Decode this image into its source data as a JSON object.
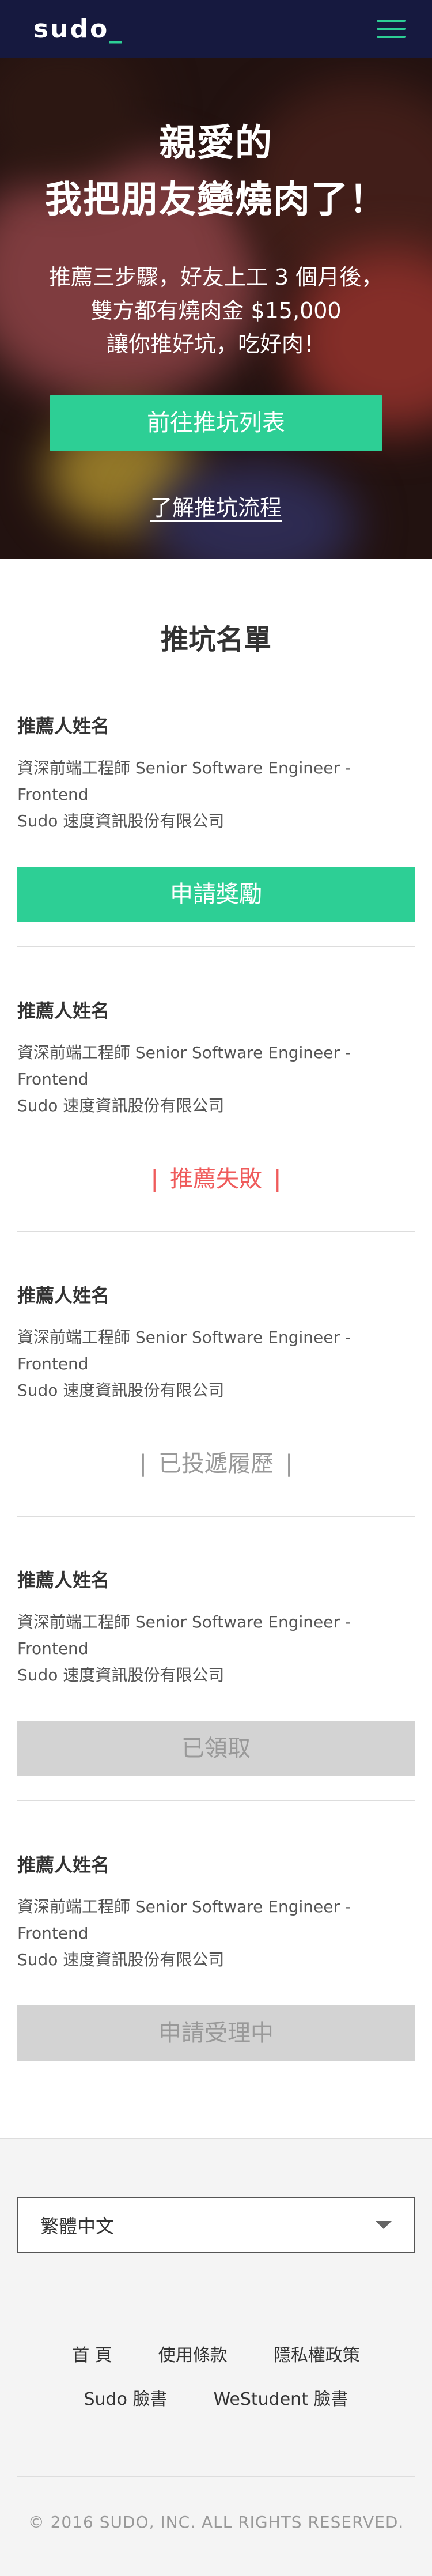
{
  "header": {
    "logo_text": "sudo",
    "logo_cursor": "_",
    "menu_icon": "hamburger-icon",
    "accent_color": "#2dcf95",
    "bg_color": "#16193f"
  },
  "hero": {
    "title_line1": "親愛的",
    "title_line2": "我把朋友變燒肉了！",
    "sub_line1": "推薦三步驟，好友上工 3 個月後，",
    "sub_line2": "雙方都有燒肉金 $15,000",
    "sub_line3": "讓你推好坑，吃好肉！",
    "button_label": "前往推坑列表",
    "link_label": "了解推坑流程"
  },
  "list": {
    "title": "推坑名單",
    "entries": [
      {
        "name": "推薦人姓名",
        "job": "資深前端工程師 Senior Software Engineer - Frontend",
        "company": "Sudo 速度資訊股份有限公司",
        "action_type": "button-primary",
        "action_label": "申請獎勵"
      },
      {
        "name": "推薦人姓名",
        "job": "資深前端工程師 Senior Software Engineer - Frontend",
        "company": "Sudo 速度資訊股份有限公司",
        "action_type": "status-fail",
        "action_label": "推薦失敗",
        "status_color": "#ef5b5b"
      },
      {
        "name": "推薦人姓名",
        "job": "資深前端工程師 Senior Software Engineer - Frontend",
        "company": "Sudo 速度資訊股份有限公司",
        "action_type": "status-sent",
        "action_label": "已投遞履歷",
        "status_color": "#999999"
      },
      {
        "name": "推薦人姓名",
        "job": "資深前端工程師 Senior Software Engineer - Frontend",
        "company": "Sudo 速度資訊股份有限公司",
        "action_type": "button-disabled",
        "action_label": "已領取"
      },
      {
        "name": "推薦人姓名",
        "job": "資深前端工程師 Senior Software Engineer - Frontend",
        "company": "Sudo 速度資訊股份有限公司",
        "action_type": "button-disabled",
        "action_label": "申請受理中"
      }
    ]
  },
  "footer": {
    "language_selected": "繁體中文",
    "links_row1": [
      "首 頁",
      "使用條款",
      "隱私權政策"
    ],
    "links_row2": [
      "Sudo 臉書",
      "WeStudent 臉書"
    ],
    "copyright": "© 2016 SUDO, INC. ALL RIGHTS RESERVED."
  }
}
